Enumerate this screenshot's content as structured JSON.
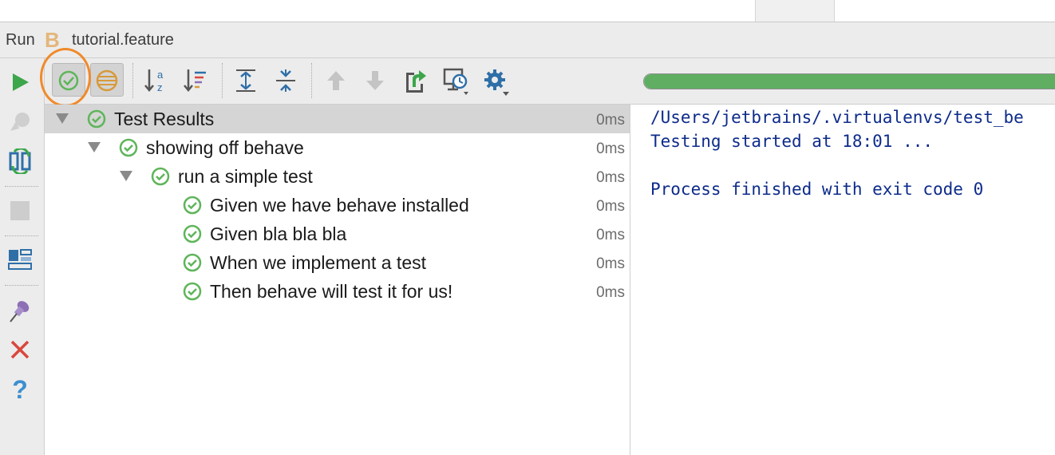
{
  "header": {
    "panel_label": "Run",
    "file_icon_letter": "B",
    "config_name": "tutorial.feature"
  },
  "toolbar": {
    "buttons": [
      "run-icon",
      "show-passed-icon",
      "show-ignored-icon",
      "sort-alpha-icon",
      "sort-duration-icon",
      "expand-all-icon",
      "collapse-all-icon",
      "previous-failed-icon",
      "next-failed-icon",
      "export-icon",
      "history-icon",
      "settings-icon"
    ],
    "progress_percent": 100,
    "progress_color": "#5fae62"
  },
  "leftbar": {
    "buttons": [
      "run-icon",
      "debug-icon",
      "rerun-failed-icon",
      "stop-icon",
      "layout-icon",
      "pin-icon",
      "close-icon",
      "help-icon"
    ]
  },
  "tree": {
    "rows": [
      {
        "label": "Test Results",
        "time": "0ms"
      },
      {
        "label": "showing off behave",
        "time": "0ms"
      },
      {
        "label": "run a simple test",
        "time": "0ms"
      },
      {
        "label": "Given we have behave installed",
        "time": "0ms"
      },
      {
        "label": "Given bla bla bla",
        "time": "0ms"
      },
      {
        "label": "When we implement a test",
        "time": "0ms"
      },
      {
        "label": "Then behave will test it for us!",
        "time": "0ms"
      }
    ]
  },
  "console": {
    "lines": [
      "/Users/jetbrains/.virtualenvs/test_be",
      "Testing started at 18:01 ...",
      "",
      "Process finished with exit code 0"
    ]
  },
  "colors": {
    "pass_green": "#5fb55a",
    "console_text": "#0d2b8a",
    "highlight_ring": "#f08a2b",
    "selected_row": "#d5d5d5"
  }
}
